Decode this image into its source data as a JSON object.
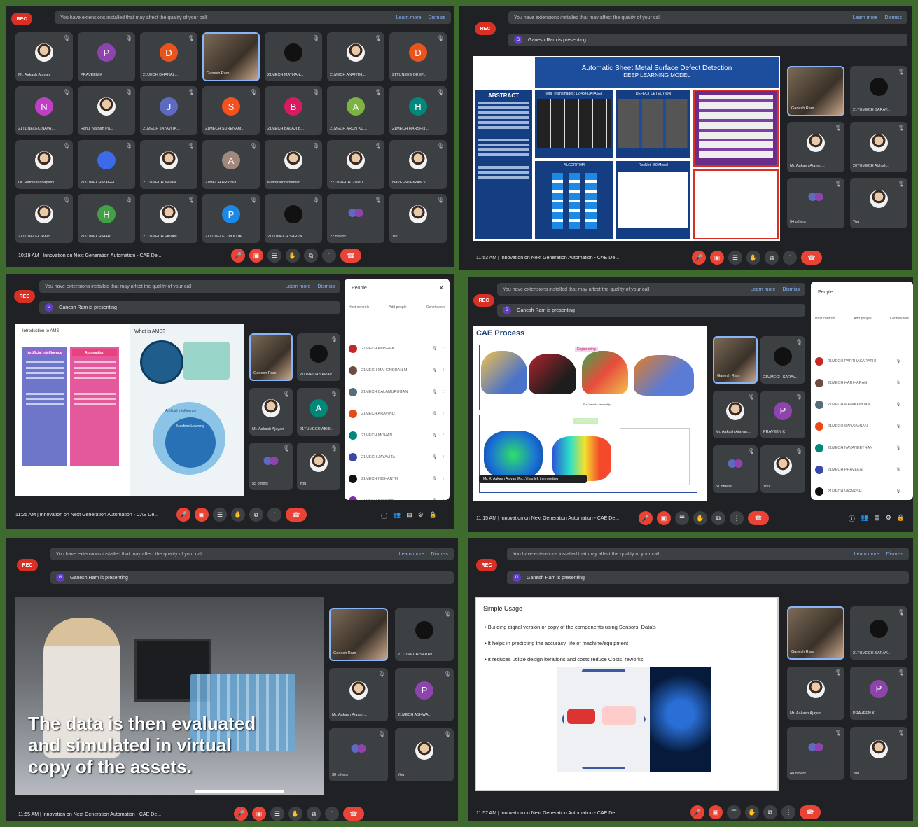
{
  "common": {
    "rec": "REC",
    "learn_more": "Learn more",
    "dismiss": "Dismiss",
    "meeting": "Innovation on Next Generation Automation - CAE De...",
    "you": "You"
  },
  "panels": [
    {
      "notice": "You have extensions installed that may affect the quality of your call",
      "time": "10:19 AM",
      "presenting": ""
    },
    {
      "notice": "You have extensions installed that may affect the quality of your call",
      "time": "11:53 AM",
      "presenting": "Ganesh Ram is presenting"
    },
    {
      "notice": "You have extensions installed that may affect the quality of your call",
      "time": "11:26 AM",
      "presenting": "Ganesh Ram is presenting"
    },
    {
      "notice": "You have extensions installed that may affect the quality of your call",
      "time": "11:15 AM",
      "presenting": "Ganesh Ram is presenting"
    },
    {
      "notice": "You have extensions installed that may affect the quality of your call",
      "time": "11:55 AM",
      "presenting": "Ganesh Ram is presenting"
    },
    {
      "notice": "You have extensions installed that may affect the quality of your call",
      "time": "11:57 AM",
      "presenting": "Ganesh Ram is presenting"
    }
  ],
  "grid_tiles": [
    {
      "name": "Mr. Aakash Ajayan",
      "letter": "",
      "color": "",
      "kind": "face"
    },
    {
      "name": "PRAVEEN K",
      "letter": "P",
      "color": "#8e44ad",
      "kind": "letter"
    },
    {
      "name": "21UECH DHANAL...",
      "letter": "D",
      "color": "#e8541c",
      "kind": "letter"
    },
    {
      "name": "Ganesh Ram",
      "letter": "",
      "color": "",
      "kind": "speaker"
    },
    {
      "name": "21MECH MATHAN...",
      "letter": "",
      "color": "",
      "kind": "black"
    },
    {
      "name": "21MECH ANANTH...",
      "letter": "",
      "color": "",
      "kind": "face"
    },
    {
      "name": "21TUNEEE DEEP...",
      "letter": "D",
      "color": "#e8541c",
      "kind": "letter"
    },
    {
      "name": "21TUNELEC NAVA...",
      "letter": "N",
      "color": "#c13ec7",
      "kind": "letter"
    },
    {
      "name": "Rahul Nathan Pa...",
      "letter": "",
      "color": "",
      "kind": "face"
    },
    {
      "name": "21MECH JAYAVITA...",
      "letter": "J",
      "color": "#5c6bc0",
      "kind": "letter"
    },
    {
      "name": "21MECH SURENAM...",
      "letter": "S",
      "color": "#f4511e",
      "kind": "letter"
    },
    {
      "name": "21MECH BALAJI B...",
      "letter": "B",
      "color": "#d81b60",
      "kind": "letter"
    },
    {
      "name": "21MECH ARUN KU...",
      "letter": "A",
      "color": "#7cb342",
      "kind": "letter"
    },
    {
      "name": "21MECH HARSHIT...",
      "letter": "H",
      "color": "#00897b",
      "kind": "letter"
    },
    {
      "name": "Dr. Rathinasabapathi",
      "letter": "",
      "color": "",
      "kind": "face"
    },
    {
      "name": "21TUMECH RAGHU...",
      "letter": "",
      "color": "#3b6be8",
      "kind": "letter"
    },
    {
      "name": "21TUMECH KAVIN...",
      "letter": "",
      "color": "",
      "kind": "face"
    },
    {
      "name": "21MECH ARVIND...",
      "letter": "A",
      "color": "#a1887f",
      "kind": "letter"
    },
    {
      "name": "Muthusubramanian",
      "letter": "",
      "color": "",
      "kind": "face"
    },
    {
      "name": "22TUMECH GURU...",
      "letter": "",
      "color": "",
      "kind": "face"
    },
    {
      "name": "NAVEENTHIRAN V...",
      "letter": "",
      "color": "",
      "kind": "face"
    },
    {
      "name": "21TUNELEC RAVI...",
      "letter": "",
      "color": "",
      "kind": "face"
    },
    {
      "name": "21TUMECH HARI...",
      "letter": "H",
      "color": "#43a047",
      "kind": "letter"
    },
    {
      "name": "21TUMECH PAVAN...",
      "letter": "",
      "color": "",
      "kind": "face"
    },
    {
      "name": "21TUNELEC POOJA...",
      "letter": "P",
      "color": "#1e88e5",
      "kind": "letter"
    },
    {
      "name": "21TUMECH SARVA...",
      "letter": "",
      "color": "",
      "kind": "black"
    },
    {
      "name": "22 others",
      "letter": "",
      "color": "",
      "kind": "others"
    },
    {
      "name": "You",
      "letter": "",
      "color": "",
      "kind": "face"
    }
  ],
  "side_tiles": {
    "p2": [
      {
        "name": "Ganesh Ram",
        "kind": "speaker",
        "letter": "",
        "color": ""
      },
      {
        "name": "21TUMECH SARAV...",
        "kind": "black",
        "letter": "",
        "color": ""
      },
      {
        "name": "Mr. Aakash Ajayan...",
        "kind": "face",
        "letter": "",
        "color": ""
      },
      {
        "name": "20TUMECH Abhish...",
        "kind": "face",
        "letter": "",
        "color": ""
      },
      {
        "name": "54 others",
        "kind": "others",
        "letter": "",
        "color": ""
      },
      {
        "name": "You",
        "kind": "face",
        "letter": "",
        "color": ""
      }
    ],
    "p3": [
      {
        "name": "Ganesh Ram",
        "kind": "speaker",
        "letter": "",
        "color": ""
      },
      {
        "name": "21UMECH SARAV...",
        "kind": "black",
        "letter": "",
        "color": ""
      },
      {
        "name": "Mr. Aakash Ajayan",
        "kind": "face",
        "letter": "",
        "color": ""
      },
      {
        "name": "21TUMECH ABHI...",
        "kind": "letter",
        "letter": "A",
        "color": "#00897b"
      },
      {
        "name": "55 others",
        "kind": "others",
        "letter": "",
        "color": ""
      },
      {
        "name": "You",
        "kind": "face",
        "letter": "",
        "color": ""
      }
    ],
    "p4": [
      {
        "name": "Ganesh Ram",
        "kind": "speaker",
        "letter": "",
        "color": ""
      },
      {
        "name": "21UMECH SARAV...",
        "kind": "black",
        "letter": "",
        "color": ""
      },
      {
        "name": "Mr. Aakash Ajayan...",
        "kind": "face",
        "letter": "",
        "color": ""
      },
      {
        "name": "PRAVEEN K",
        "kind": "letter",
        "letter": "P",
        "color": "#8e44ad"
      },
      {
        "name": "51 others",
        "kind": "others",
        "letter": "",
        "color": ""
      },
      {
        "name": "You",
        "kind": "face",
        "letter": "",
        "color": ""
      }
    ],
    "p5": [
      {
        "name": "Ganesh Ram",
        "kind": "speaker",
        "letter": "",
        "color": ""
      },
      {
        "name": "21TUMECH SARAV...",
        "kind": "black",
        "letter": "",
        "color": ""
      },
      {
        "name": "Mr. Aakash Ajayan...",
        "kind": "face",
        "letter": "",
        "color": ""
      },
      {
        "name": "21MECH ASHWA...",
        "kind": "letter",
        "letter": "P",
        "color": "#8e44ad"
      },
      {
        "name": "30 others",
        "kind": "others",
        "letter": "",
        "color": ""
      },
      {
        "name": "You",
        "kind": "face",
        "letter": "",
        "color": ""
      }
    ],
    "p6": [
      {
        "name": "Ganesh Ram",
        "kind": "speaker",
        "letter": "",
        "color": ""
      },
      {
        "name": "21TUMECH SARAV...",
        "kind": "black",
        "letter": "",
        "color": ""
      },
      {
        "name": "Mr. Aakash Ajayan",
        "kind": "face",
        "letter": "",
        "color": ""
      },
      {
        "name": "PRAVEEN K",
        "kind": "letter",
        "letter": "P",
        "color": "#8e44ad"
      },
      {
        "name": "48 others",
        "kind": "others",
        "letter": "",
        "color": ""
      },
      {
        "name": "You",
        "kind": "face",
        "letter": "",
        "color": ""
      }
    ]
  },
  "slide2": {
    "title": "Automatic Sheet Metal Surface Defect Detection",
    "subtitle": "DEEP LEARNING MODEL",
    "abstract_h": "ABSTRACT",
    "dataset": "Total Train Images: 12,484 DATASET",
    "defects": "DEFECT DETECTION",
    "algorithm": "ALGORITHM",
    "resnet": "ResNet - 50 Model"
  },
  "slide3": {
    "header": "Introduction to AMS",
    "q": "What is AMS?",
    "col1": "Artificial Intelligence",
    "col2": "Automation",
    "ai": "Artificial Intelligence",
    "ml": "Machine Learning"
  },
  "panel3": {
    "title": "People",
    "tabs": [
      "Host controls",
      "Add people",
      "Contributors"
    ],
    "people": [
      "21MECH ABISHEK",
      "21MECH MAHENDRAN M",
      "21MECH BALAMURUGAN",
      "21MECH ARAVIND",
      "21MECH MOHAN",
      "21MECH JAYAVITA",
      "21MECH NISHANTH",
      "21MECH KANNAN"
    ]
  },
  "slide4": {
    "title": "CAE Process",
    "engineering": "Engineering",
    "caption1": "Full Vehicle Assembly",
    "caption2": "Crash testing",
    "toast": "Mr. K. Aakash Ajayan (Fa...) has left the meeting"
  },
  "panel4": {
    "title": "People",
    "tabs": [
      "Host controls",
      "Add people",
      "Contributors"
    ],
    "people": [
      "21MECH PARTHASARATHI",
      "21MECH HARIHARAN",
      "21MECH MANIKANDAN",
      "21MECH SARAVANAN",
      "21MECH NAVANEETHAN",
      "21MECH PRAVEEN",
      "21MECH VIGNESH"
    ]
  },
  "slide5": {
    "caption": "The data is then evaluated and simulated in virtual copy of the assets."
  },
  "slide6": {
    "title": "Simple Usage",
    "bullets": [
      "Building digital version or copy of the components using Sensors, Data's",
      "It helps in predicting the accuracy, life of machine/equipment",
      "It reduces utilize design iterations and costs reduce Costs, reworks"
    ]
  },
  "colors": {
    "bg": "#3f6a2e",
    "panel": "#202124",
    "tile": "#3c4043",
    "red": "#ea4335",
    "blue": "#8ab4f8"
  }
}
